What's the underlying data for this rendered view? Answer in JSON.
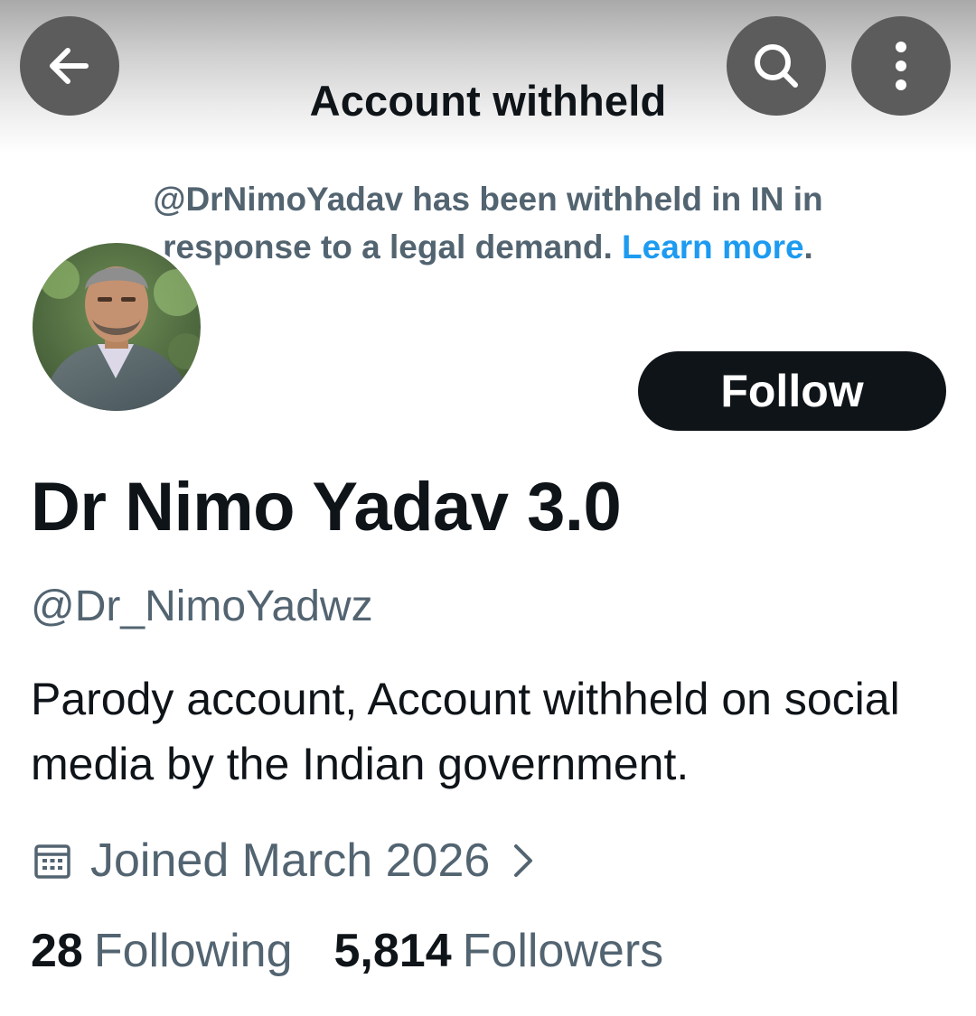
{
  "header": {
    "title": "Account withheld",
    "back_icon": "arrow-left-icon",
    "search_icon": "search-icon",
    "more_icon": "more-vertical-icon"
  },
  "notice": {
    "text": "@DrNimoYadav has been withheld in IN in response to a legal demand.",
    "link": "Learn more",
    "period": "."
  },
  "profile": {
    "display_name": "Dr Nimo Yadav 3.0",
    "handle": "@Dr_NimoYadwz",
    "bio": "Parody account, Account withheld on social media by the Indian government.",
    "joined": "Joined March 2026",
    "follow_label": "Follow",
    "following_count": "28",
    "following_label": "Following",
    "followers_count": "5,814",
    "followers_label": "Followers"
  },
  "colors": {
    "primary_text": "#0f1419",
    "secondary_text": "#536471",
    "link": "#1d9bf0",
    "follow_bg": "#0f1419",
    "icon_button_bg": "#5c5c5c"
  }
}
